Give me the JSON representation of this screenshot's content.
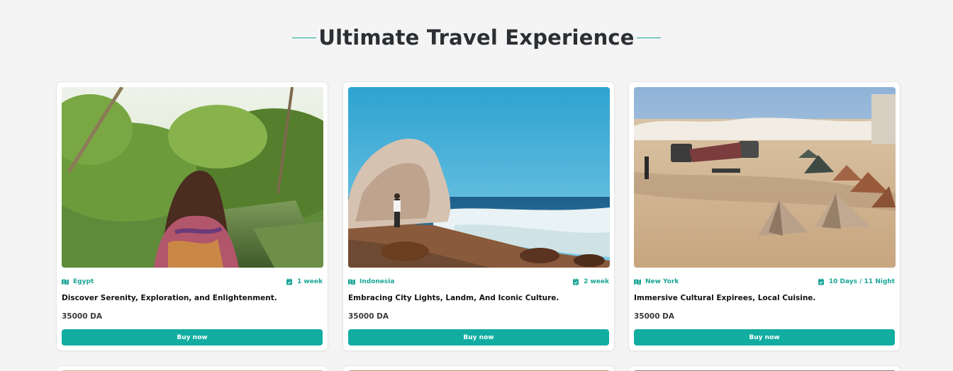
{
  "heading": "Ultimate Travel Experience",
  "colors": {
    "accent": "#12ada1",
    "meta_text": "#1ba597",
    "background": "#f4f4f4"
  },
  "cards": [
    {
      "location": "Egypt",
      "duration": "1 week",
      "title": "Discover Serenity, Exploration, and Enlightenment.",
      "price": "35000 DA",
      "button": "Buy now",
      "image": "woman-on-boat-canal-palms-photo"
    },
    {
      "location": "Indonesia",
      "duration": "2 week",
      "title": "Embracing City Lights, Landm, And Iconic Culture.",
      "price": "35000 DA",
      "button": "Buy now",
      "image": "rock-beach-ocean-photo"
    },
    {
      "location": "New York",
      "duration": "10 Days / 11 Night",
      "title": "Immersive Cultural Expirees, Local Cuisine.",
      "price": "35000 DA",
      "button": "Buy now",
      "image": "desert-camp-tents-photo"
    }
  ],
  "icons": {
    "location": "map-icon",
    "duration": "calendar-icon"
  }
}
